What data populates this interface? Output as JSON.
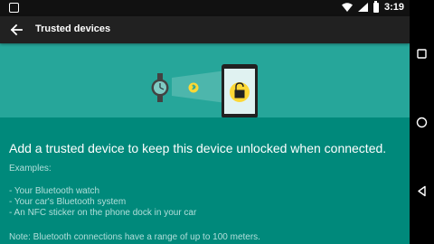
{
  "status_bar": {
    "time": "3:19",
    "left_icon": "notification-square-icon",
    "icons": [
      "wifi-icon",
      "cell-signal-icon",
      "battery-icon"
    ]
  },
  "toolbar": {
    "back_icon": "arrow-back-icon",
    "title": "Trusted devices"
  },
  "hero": {
    "illustration": [
      "smartwatch-icon",
      "bluetooth-icon",
      "tablet-icon",
      "unlocked-padlock-icon"
    ]
  },
  "content": {
    "headline": "Add a trusted device to keep this device unlocked when connected.",
    "examples_label": "Examples:",
    "examples": [
      "- Your Bluetooth watch",
      "- Your car's Bluetooth system",
      "- An NFC sticker on the phone dock in your car"
    ],
    "note": "Note: Bluetooth connections have a range of up to 100 meters."
  },
  "nav_bar": {
    "buttons": [
      "recents-square-icon",
      "home-circle-icon",
      "back-triangle-icon"
    ]
  },
  "colors": {
    "primary_dark": "#00897b",
    "hero": "#26a69a",
    "toolbar": "#212121",
    "lock_yellow": "#fdd835"
  }
}
